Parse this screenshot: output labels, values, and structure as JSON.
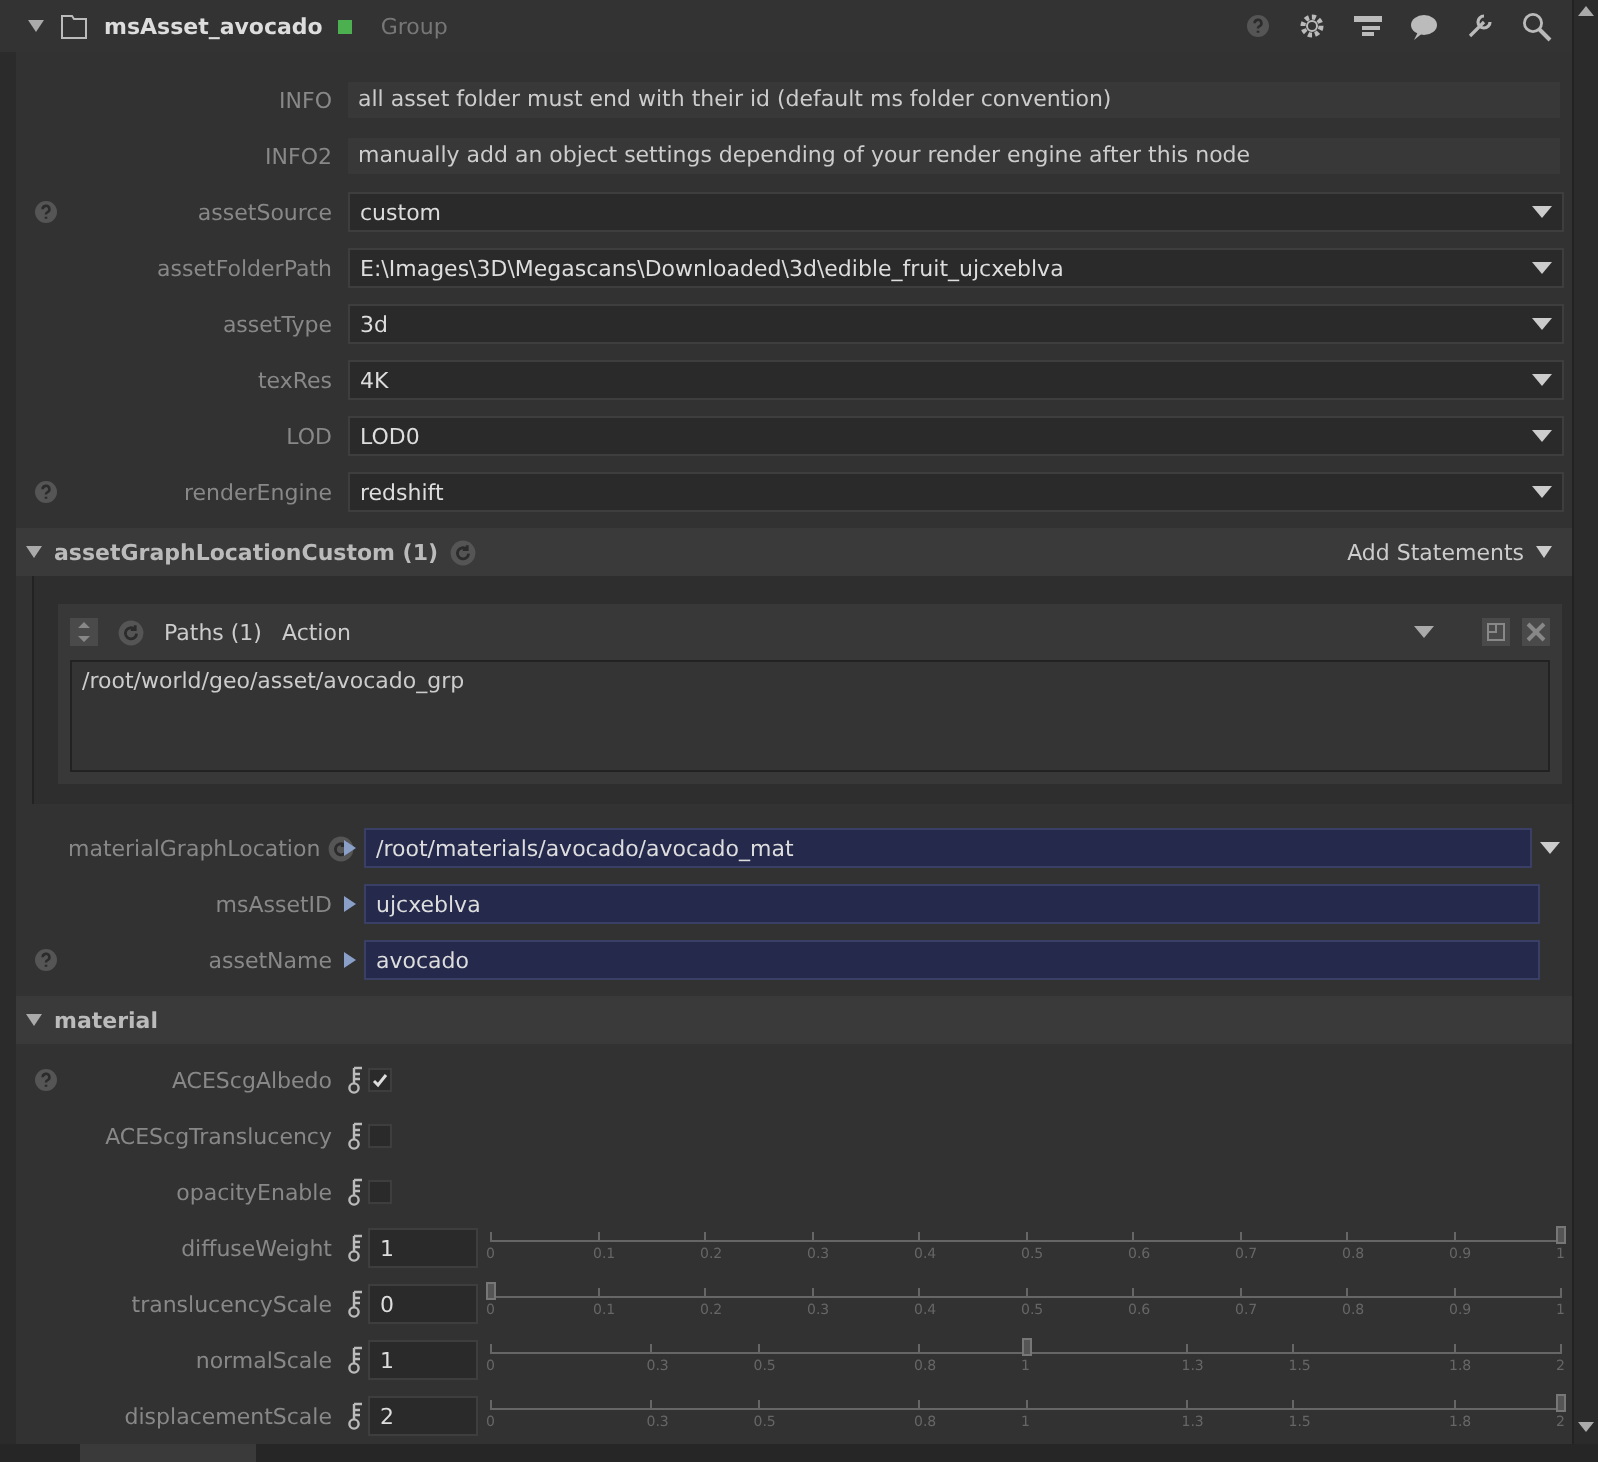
{
  "node": {
    "name": "msAsset_avocado",
    "type": "Group"
  },
  "params": [
    {
      "kind": "info",
      "label": "INFO",
      "value": "all asset folder must end with their id (default ms folder convention)",
      "help": false
    },
    {
      "kind": "info",
      "label": "INFO2",
      "value": "manually add an object settings depending of your render engine after this node",
      "help": false
    },
    {
      "kind": "dropdown",
      "label": "assetSource",
      "value": "custom",
      "help": true
    },
    {
      "kind": "dropdown",
      "label": "assetFolderPath",
      "value": "E:\\Images\\3D\\Megascans\\Downloaded\\3d\\edible_fruit_ujcxeblva",
      "help": false
    },
    {
      "kind": "dropdown",
      "label": "assetType",
      "value": "3d",
      "help": false
    },
    {
      "kind": "dropdown",
      "label": "texRes",
      "value": "4K",
      "help": false
    },
    {
      "kind": "dropdown",
      "label": "LOD",
      "value": "LOD0",
      "help": false
    },
    {
      "kind": "dropdown",
      "label": "renderEngine",
      "value": "redshift",
      "help": true
    }
  ],
  "group": {
    "title": "assetGraphLocationCustom (1)",
    "expanded": true,
    "add_button": "Add Statements",
    "tabs": [
      "Paths (1)",
      "Action"
    ],
    "paths": "/root/world/geo/asset/avocado_grp"
  },
  "expressions": [
    {
      "label": "materialGraphLocation",
      "value": "/root/materials/avocado/avocado_mat",
      "reset": true,
      "menu": true,
      "help": false
    },
    {
      "label": "msAssetID",
      "value": "ujcxeblva",
      "reset": false,
      "menu": false,
      "help": false
    },
    {
      "label": "assetName",
      "value": "avocado",
      "reset": false,
      "menu": false,
      "help": true
    }
  ],
  "material": {
    "title": "material",
    "expanded": true,
    "rows": [
      {
        "kind": "checkbox",
        "label": "ACEScgAlbedo",
        "checked": true,
        "help": true
      },
      {
        "kind": "checkbox",
        "label": "ACEScgTranslucency",
        "checked": false,
        "help": false
      },
      {
        "kind": "checkbox",
        "label": "opacityEnable",
        "checked": false,
        "help": false
      },
      {
        "kind": "slider",
        "label": "diffuseWeight",
        "value": "1",
        "level": 1,
        "ticks": [
          "0",
          "0.1",
          "0.2",
          "0.3",
          "0.4",
          "0.5",
          "0.6",
          "0.7",
          "0.8",
          "0.9",
          "1"
        ],
        "help": false
      },
      {
        "kind": "slider",
        "label": "translucencyScale",
        "value": "0",
        "level": 0,
        "ticks": [
          "0",
          "0.1",
          "0.2",
          "0.3",
          "0.4",
          "0.5",
          "0.6",
          "0.7",
          "0.8",
          "0.9",
          "1"
        ],
        "help": false
      },
      {
        "kind": "slider",
        "label": "normalScale",
        "value": "1",
        "level": 0.5,
        "ticks": [
          "0",
          "0.3",
          "0.5",
          "0.8",
          "1",
          "1.3",
          "1.5",
          "1.8",
          "2"
        ],
        "help": false
      },
      {
        "kind": "slider",
        "label": "displacementScale",
        "value": "2",
        "level": 1,
        "ticks": [
          "0",
          "0.3",
          "0.5",
          "0.8",
          "1",
          "1.3",
          "1.5",
          "1.8",
          "2"
        ],
        "help": false
      }
    ]
  }
}
